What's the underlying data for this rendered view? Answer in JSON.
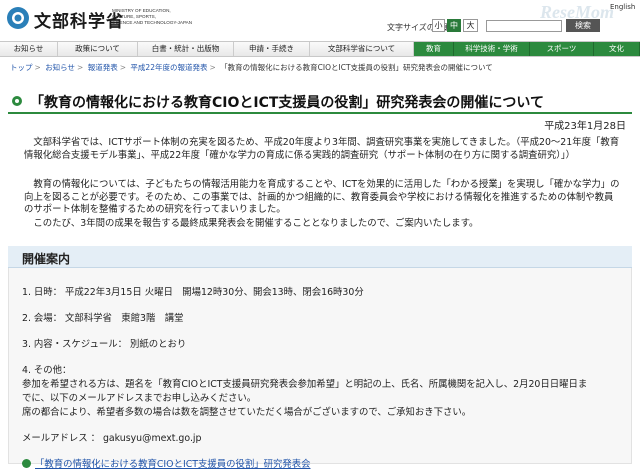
{
  "header": {
    "logo_text": "文部科学省",
    "logo_sub_1": "MINISTRY OF EDUCATION,",
    "logo_sub_2": "CULTURE, SPORTS,",
    "logo_sub_3": "SCIENCE AND TECHNOLOGY-JAPAN",
    "text_size_label": "文字サイズの変更",
    "size_small": "小",
    "size_medium": "中",
    "size_large": "大",
    "search_label": "検索",
    "english_link": "English",
    "watermark": "ReseMom",
    "brand_color": "#2c8a3e"
  },
  "nav": {
    "items": [
      {
        "label": "お知らせ"
      },
      {
        "label": "政策について"
      },
      {
        "label": "白書・統計・出版物"
      },
      {
        "label": "申請・手続き"
      },
      {
        "label": "文部科学省について"
      },
      {
        "label": "教育"
      },
      {
        "label": "科学技術・学術"
      },
      {
        "label": "スポーツ"
      },
      {
        "label": "文化"
      }
    ]
  },
  "breadcrumb": {
    "items": [
      "トップ",
      "お知らせ",
      "報道発表",
      "平成22年度の報道発表"
    ],
    "current": "「教育の情報化における教育CIOとICT支援員の役割」研究発表会の開催について"
  },
  "article": {
    "title": "「教育の情報化における教育CIOとICT支援員の役割」研究発表会の開催について",
    "date": "平成23年1月28日",
    "p1": "文部科学省では、ICTサポート体制の充実を図るため、平成20年度より3年間、調査研究事業を実施してきました。（平成20～21年度「教育情報化総合支援モデル事業」、平成22年度「確かな学力の育成に係る実践的調査研究（サポート体制の在り方に関する調査研究）」）",
    "p2": "教育の情報化については、子どもたちの情報活用能力を育成することや、ICTを効果的に活用した「わかる授業」を実現し「確かな学力」の向上を図ることが必要です。そのため、この事業では、計画的かつ組織的に、教育委員会や学校における情報化を推進するための体制や教員のサポート体制を整備するための研究を行ってまいりました。",
    "p3": "このたび、3年間の成果を報告する最終成果発表会を開催することとなりましたので、ご案内いたします。"
  },
  "section": {
    "title": "開催案内",
    "item1": "1. 日時： 平成22年3月15日 火曜日　開場12時30分、開会13時、閉会16時30分",
    "item2": "2. 会場： 文部科学省　東館3階　講堂",
    "item3": "3. 内容・スケジュール： 別紙のとおり",
    "item4": "4. その他：",
    "item4a": "参加を希望される方は、題名を「教育CIOとICT支援員研究発表会参加希望」と明記の上、氏名、所属機関を記入し、2月20日日曜日ま",
    "item4b": "でに、以下のメールアドレスまでお申し込みください。",
    "item4c": "席の都合により、希望者多数の場合は数を調整させていただく場合がございますので、ご承知おき下さい。",
    "email": "メールアドレス ： gakusyu@mext.go.jp",
    "link": "「教育の情報化における教育CIOとICT支援員の役割」研究発表会"
  }
}
